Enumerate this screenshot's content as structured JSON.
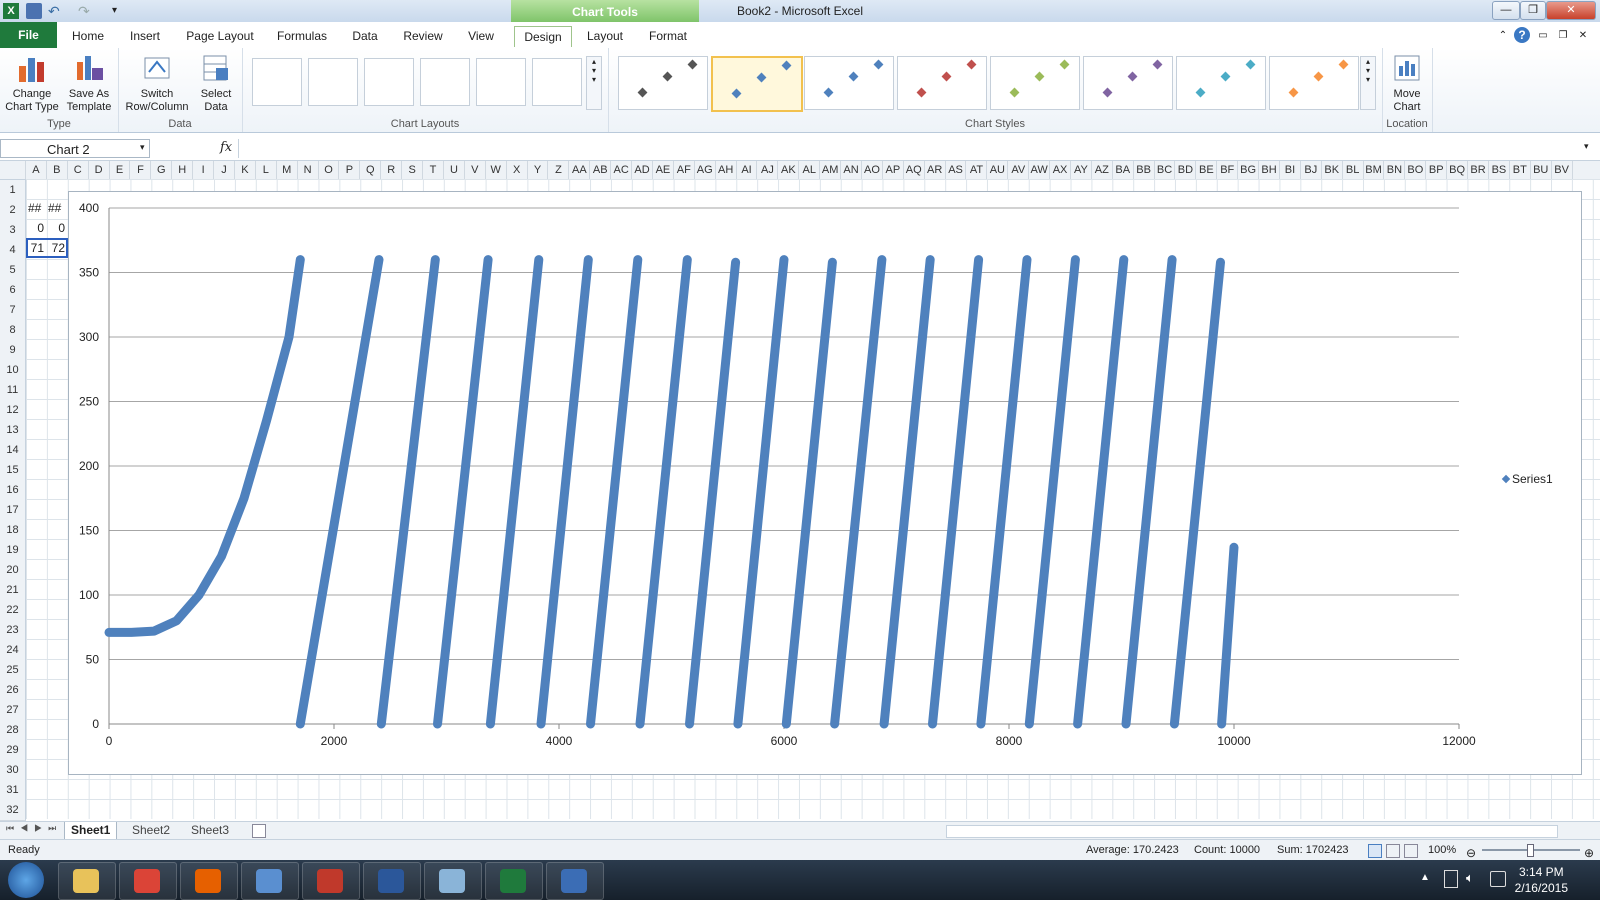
{
  "window": {
    "title": "Book2  -  Microsoft Excel",
    "controls": {
      "minimize": "—",
      "restore": "❐",
      "close": "✕"
    }
  },
  "ribbon": {
    "context_label": "Chart Tools",
    "tabs": [
      "File",
      "Home",
      "Insert",
      "Page Layout",
      "Formulas",
      "Data",
      "Review",
      "View",
      "Design",
      "Layout",
      "Format"
    ],
    "active_tab": "Design",
    "groups": {
      "type": {
        "label": "Type",
        "change_chart_type": [
          "Change",
          "Chart Type"
        ],
        "save_as_template": [
          "Save As",
          "Template"
        ]
      },
      "data": {
        "label": "Data",
        "switch_row_column": [
          "Switch",
          "Row/Column"
        ],
        "select_data": [
          "Select",
          "Data"
        ]
      },
      "chart_layouts": {
        "label": "Chart Layouts"
      },
      "chart_styles": {
        "label": "Chart Styles",
        "colors": [
          "#555555",
          "#4f81bd",
          "#4f81bd",
          "#c0504d",
          "#9bbb59",
          "#8064a2",
          "#4bacc6",
          "#f79646"
        ],
        "selected_index": 1
      },
      "location": {
        "label": "Location",
        "move_chart": [
          "Move",
          "Chart"
        ]
      }
    }
  },
  "formula_bar": {
    "name_box": "Chart 2",
    "fx": "fx",
    "formula": ""
  },
  "grid": {
    "columns": [
      "A",
      "B",
      "C",
      "D",
      "E",
      "F",
      "G",
      "H",
      "I",
      "J",
      "K",
      "L",
      "M",
      "N",
      "O",
      "P",
      "Q",
      "R",
      "S",
      "T",
      "U",
      "V",
      "W",
      "X",
      "Y",
      "Z",
      "AA",
      "AB",
      "AC",
      "AD",
      "AE",
      "AF",
      "AG",
      "AH",
      "AI",
      "AJ",
      "AK",
      "AL",
      "AM",
      "AN",
      "AO",
      "AP",
      "AQ",
      "AR",
      "AS",
      "AT",
      "AU",
      "AV",
      "AW",
      "AX",
      "AY",
      "AZ",
      "BA",
      "BB",
      "BC",
      "BD",
      "BE",
      "BF",
      "BG",
      "BH",
      "BI",
      "BJ",
      "BK",
      "BL",
      "BM",
      "BN",
      "BO",
      "BP",
      "BQ",
      "BR",
      "BS",
      "BT",
      "BU",
      "BV"
    ],
    "rows": [
      "1",
      "2",
      "3",
      "4",
      "5",
      "6",
      "7",
      "8",
      "9",
      "10",
      "11",
      "12",
      "13",
      "14",
      "15",
      "16",
      "17",
      "18",
      "19",
      "20",
      "21",
      "22",
      "23",
      "24",
      "25",
      "26",
      "27",
      "28",
      "29",
      "30",
      "31",
      "32"
    ],
    "cells": {
      "A2": "##",
      "B2": "##",
      "A3": "0",
      "B3": "0",
      "A4": "71",
      "B4": "72"
    }
  },
  "chart_data": {
    "type": "scatter",
    "legend": "right",
    "marker": "diamond",
    "color": "#4f81bd",
    "xlim": [
      0,
      12000
    ],
    "ylim": [
      0,
      400
    ],
    "x_ticks": [
      0,
      2000,
      4000,
      6000,
      8000,
      10000,
      12000
    ],
    "y_ticks": [
      0,
      50,
      100,
      150,
      200,
      250,
      300,
      350,
      400
    ],
    "grid": "horizontal",
    "series": [
      {
        "name": "Series1",
        "segments": [
          {
            "points": [
              [
                0,
                71
              ],
              [
                200,
                71
              ],
              [
                400,
                72
              ],
              [
                600,
                80
              ],
              [
                800,
                100
              ],
              [
                1000,
                130
              ],
              [
                1200,
                175
              ],
              [
                1400,
                235
              ],
              [
                1600,
                300
              ],
              [
                1700,
                360
              ]
            ]
          },
          {
            "points": [
              [
                1700,
                0
              ],
              [
                2400,
                360
              ]
            ]
          },
          {
            "points": [
              [
                2420,
                0
              ],
              [
                2900,
                360
              ]
            ]
          },
          {
            "points": [
              [
                2920,
                0
              ],
              [
                3370,
                360
              ]
            ]
          },
          {
            "points": [
              [
                3390,
                0
              ],
              [
                3820,
                360
              ]
            ]
          },
          {
            "points": [
              [
                3840,
                0
              ],
              [
                4260,
                360
              ]
            ]
          },
          {
            "points": [
              [
                4280,
                0
              ],
              [
                4700,
                360
              ]
            ]
          },
          {
            "points": [
              [
                4720,
                0
              ],
              [
                5140,
                360
              ]
            ]
          },
          {
            "points": [
              [
                5160,
                0
              ],
              [
                5570,
                358
              ]
            ]
          },
          {
            "points": [
              [
                5590,
                0
              ],
              [
                6000,
                360
              ]
            ]
          },
          {
            "points": [
              [
                6020,
                0
              ],
              [
                6430,
                358
              ]
            ]
          },
          {
            "points": [
              [
                6450,
                0
              ],
              [
                6870,
                360
              ]
            ]
          },
          {
            "points": [
              [
                6890,
                0
              ],
              [
                7300,
                360
              ]
            ]
          },
          {
            "points": [
              [
                7320,
                0
              ],
              [
                7730,
                360
              ]
            ]
          },
          {
            "points": [
              [
                7750,
                0
              ],
              [
                8160,
                360
              ]
            ]
          },
          {
            "points": [
              [
                8180,
                0
              ],
              [
                8590,
                360
              ]
            ]
          },
          {
            "points": [
              [
                8610,
                0
              ],
              [
                9020,
                360
              ]
            ]
          },
          {
            "points": [
              [
                9040,
                0
              ],
              [
                9450,
                360
              ]
            ]
          },
          {
            "points": [
              [
                9470,
                0
              ],
              [
                9880,
                358
              ]
            ]
          },
          {
            "points": [
              [
                9890,
                0
              ],
              [
                10000,
                137
              ]
            ]
          }
        ]
      }
    ]
  },
  "sheets": {
    "tabs": [
      "Sheet1",
      "Sheet2",
      "Sheet3"
    ],
    "active": "Sheet1"
  },
  "status": {
    "ready": "Ready",
    "average": "Average: 170.2423",
    "count": "Count: 10000",
    "sum": "Sum: 1702423",
    "zoom": "100%"
  },
  "taskbar": {
    "apps": [
      {
        "name": "explorer",
        "color": "#e8c25a"
      },
      {
        "name": "chrome",
        "color": "#db4437"
      },
      {
        "name": "firefox",
        "color": "#e66000"
      },
      {
        "name": "control-panel",
        "color": "#5a8fd0"
      },
      {
        "name": "toolbox",
        "color": "#c0392b"
      },
      {
        "name": "word",
        "color": "#2b579a"
      },
      {
        "name": "notepad",
        "color": "#8ab4d8"
      },
      {
        "name": "excel",
        "color": "#1f7a3c"
      },
      {
        "name": "network",
        "color": "#3b6db5"
      }
    ],
    "time": "3:14 PM",
    "date": "2/16/2015"
  }
}
